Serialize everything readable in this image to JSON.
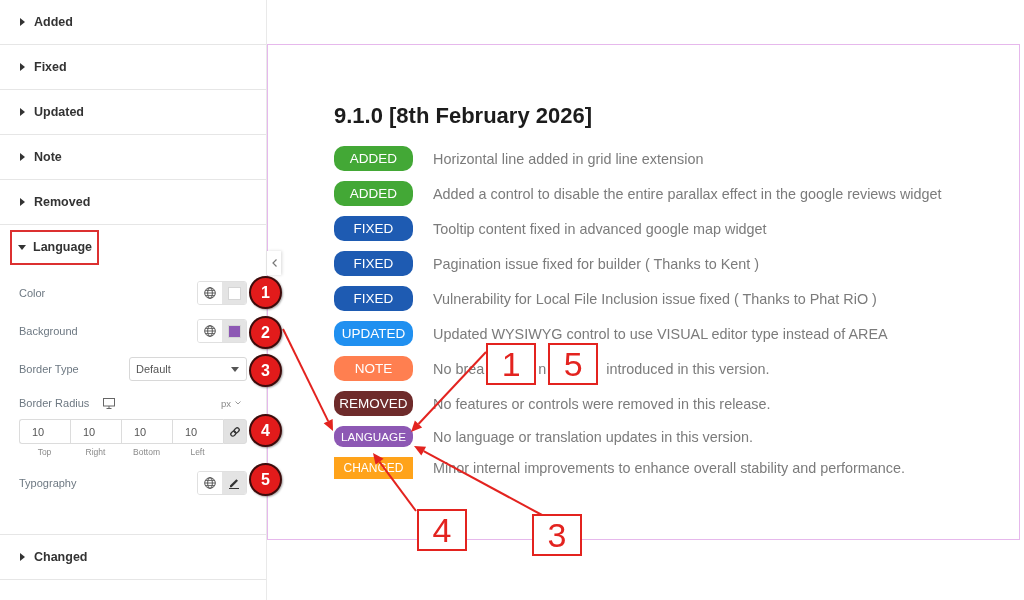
{
  "sidebar": {
    "sections": [
      {
        "label": "Added",
        "expanded": false,
        "highlighted": false
      },
      {
        "label": "Fixed",
        "expanded": false,
        "highlighted": false
      },
      {
        "label": "Updated",
        "expanded": false,
        "highlighted": false
      },
      {
        "label": "Note",
        "expanded": false,
        "highlighted": false
      },
      {
        "label": "Removed",
        "expanded": false,
        "highlighted": false
      },
      {
        "label": "Language",
        "expanded": true,
        "highlighted": true,
        "controls": [
          {
            "kind": "color",
            "label": "Color",
            "color": "#ffffff"
          },
          {
            "kind": "color",
            "label": "Background",
            "color": "#8d58b4"
          },
          {
            "kind": "select",
            "label": "Border Type",
            "value": "Default"
          },
          {
            "kind": "dimensions",
            "label": "Border Radius",
            "unit": "px",
            "linked": true,
            "fields": [
              {
                "value": "10",
                "label": "Top"
              },
              {
                "value": "10",
                "label": "Right"
              },
              {
                "value": "10",
                "label": "Bottom"
              },
              {
                "value": "10",
                "label": "Left"
              }
            ]
          },
          {
            "kind": "typography",
            "label": "Typography"
          }
        ]
      },
      {
        "label": "Changed",
        "expanded": false,
        "highlighted": false
      }
    ]
  },
  "changelog": {
    "title": "9.1.0 [8th February 2026]",
    "entries": [
      {
        "kind": "added",
        "badge": "ADDED",
        "color": "#43a836",
        "text": "Horizontal line added in grid line extension"
      },
      {
        "kind": "added",
        "badge": "ADDED",
        "color": "#43a836",
        "text": "Added a control to disable the entire parallax effect in the google reviews widget"
      },
      {
        "kind": "fixed",
        "badge": "FIXED",
        "color": "#1e5bb2",
        "text": "Tooltip content fixed in advanced google map widget"
      },
      {
        "kind": "fixed",
        "badge": "FIXED",
        "color": "#1e5bb2",
        "text": "Pagination issue fixed for builder ( Thanks to Kent )"
      },
      {
        "kind": "fixed",
        "badge": "FIXED",
        "color": "#1e5bb2",
        "text": "Vulnerability for Local File Inclusion issue fixed ( Thanks to Phat RiO )"
      },
      {
        "kind": "updated",
        "badge": "UPDATED",
        "color": "#2090f0",
        "text": "Updated WYSIWYG control to use VISUAL editor type instead of AREA"
      },
      {
        "kind": "note",
        "badge": "NOTE",
        "color": "#ff7f50",
        "text_parts": [
          "No brea",
          "n",
          "introduced in this version."
        ]
      },
      {
        "kind": "removed",
        "badge": "REMOVED",
        "color": "#6e2b2b",
        "text": "No features or controls were removed in this release."
      },
      {
        "kind": "language",
        "badge": "LANGUAGE",
        "color": "#8d58b4",
        "text": "No language or translation updates in this version."
      },
      {
        "kind": "changed",
        "badge": "CHANGED",
        "color": "#ffa31a",
        "text": "Minor internal improvements to enhance overall stability and performance."
      }
    ]
  },
  "annotations": {
    "markers": [
      "1",
      "2",
      "3",
      "4",
      "5"
    ],
    "callouts": [
      "1",
      "5",
      "4",
      "3"
    ]
  }
}
